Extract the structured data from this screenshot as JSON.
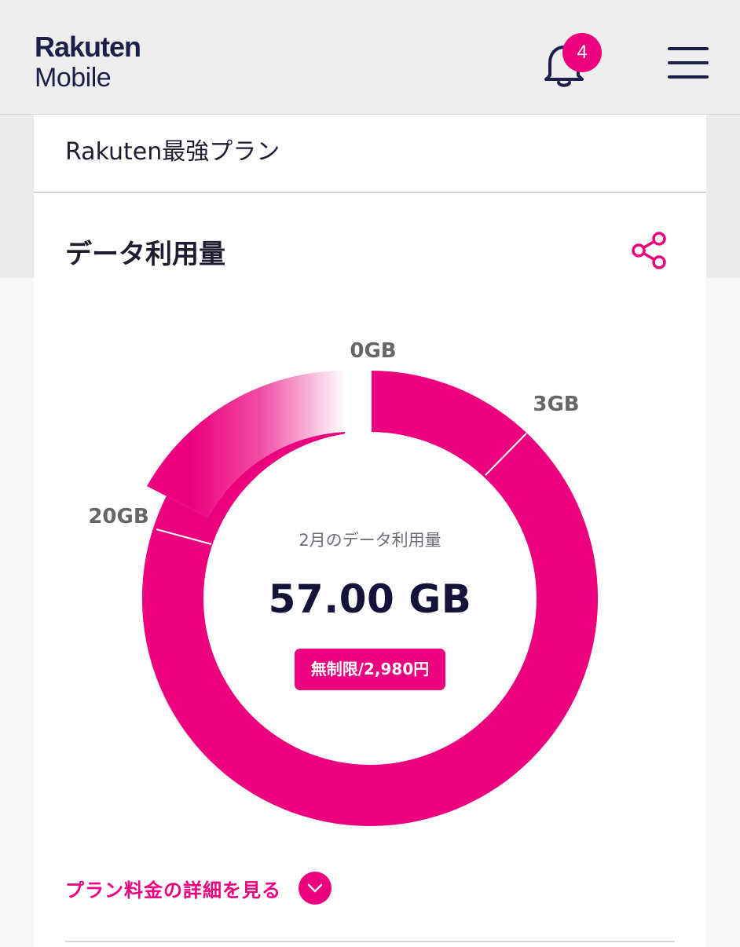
{
  "header": {
    "logo_line1": "Rakuten",
    "logo_line2": "Mobile",
    "notification_count": "4",
    "icons": [
      "bell-icon",
      "hamburger-menu-icon"
    ],
    "accent_color": "#eb007d",
    "brand_color": "#1b1f4a"
  },
  "plan": {
    "name": "Rakuten最強プラン"
  },
  "usage": {
    "title": "データ利用量",
    "share_icon": "share-icon",
    "center_label": "2月のデータ利用量",
    "center_value": "57.00 GB",
    "price_pill": "無制限/2,980円",
    "details_link": "プラン料金の詳細を見る",
    "details_icon": "chevron-down-icon"
  },
  "chart_data": {
    "type": "donut",
    "used_gb": 57.0,
    "tier_labels": [
      "0GB",
      "3GB",
      "20GB"
    ],
    "tiers_gb": [
      0,
      3,
      20
    ],
    "color": "#eb007d"
  }
}
